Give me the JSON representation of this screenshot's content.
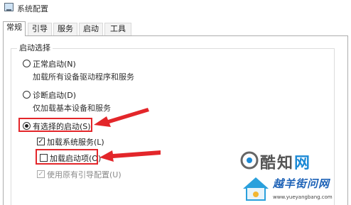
{
  "window": {
    "title": "系统配置"
  },
  "tabs": [
    {
      "label": "常规",
      "active": true
    },
    {
      "label": "引导",
      "active": false
    },
    {
      "label": "服务",
      "active": false
    },
    {
      "label": "启动",
      "active": false
    },
    {
      "label": "工具",
      "active": false
    }
  ],
  "startup_selection": {
    "group_title": "启动选择",
    "normal": {
      "label": "正常启动(N)",
      "description": "加载所有设备驱动程序和服务",
      "selected": false
    },
    "diagnostic": {
      "label": "诊断启动(D)",
      "description": "仅加载基本设备和服务",
      "selected": false
    },
    "selective": {
      "label": "有选择的启动(S)",
      "selected": true
    },
    "options": {
      "load_system_services": {
        "label": "加载系统服务(L)",
        "checked": true,
        "enabled": true
      },
      "load_startup_items": {
        "label": "加载启动项(O)",
        "checked": false,
        "enabled": true
      },
      "use_original_boot": {
        "label": "使用原有引导配置(U)",
        "checked": true,
        "enabled": false
      }
    }
  },
  "annotations": {
    "arrow_color": "#e3262a"
  },
  "watermark": {
    "brand_a": "酷知",
    "brand_b": "网",
    "site_name": "越羊街问网",
    "url": "www.yueyangbang.com"
  }
}
